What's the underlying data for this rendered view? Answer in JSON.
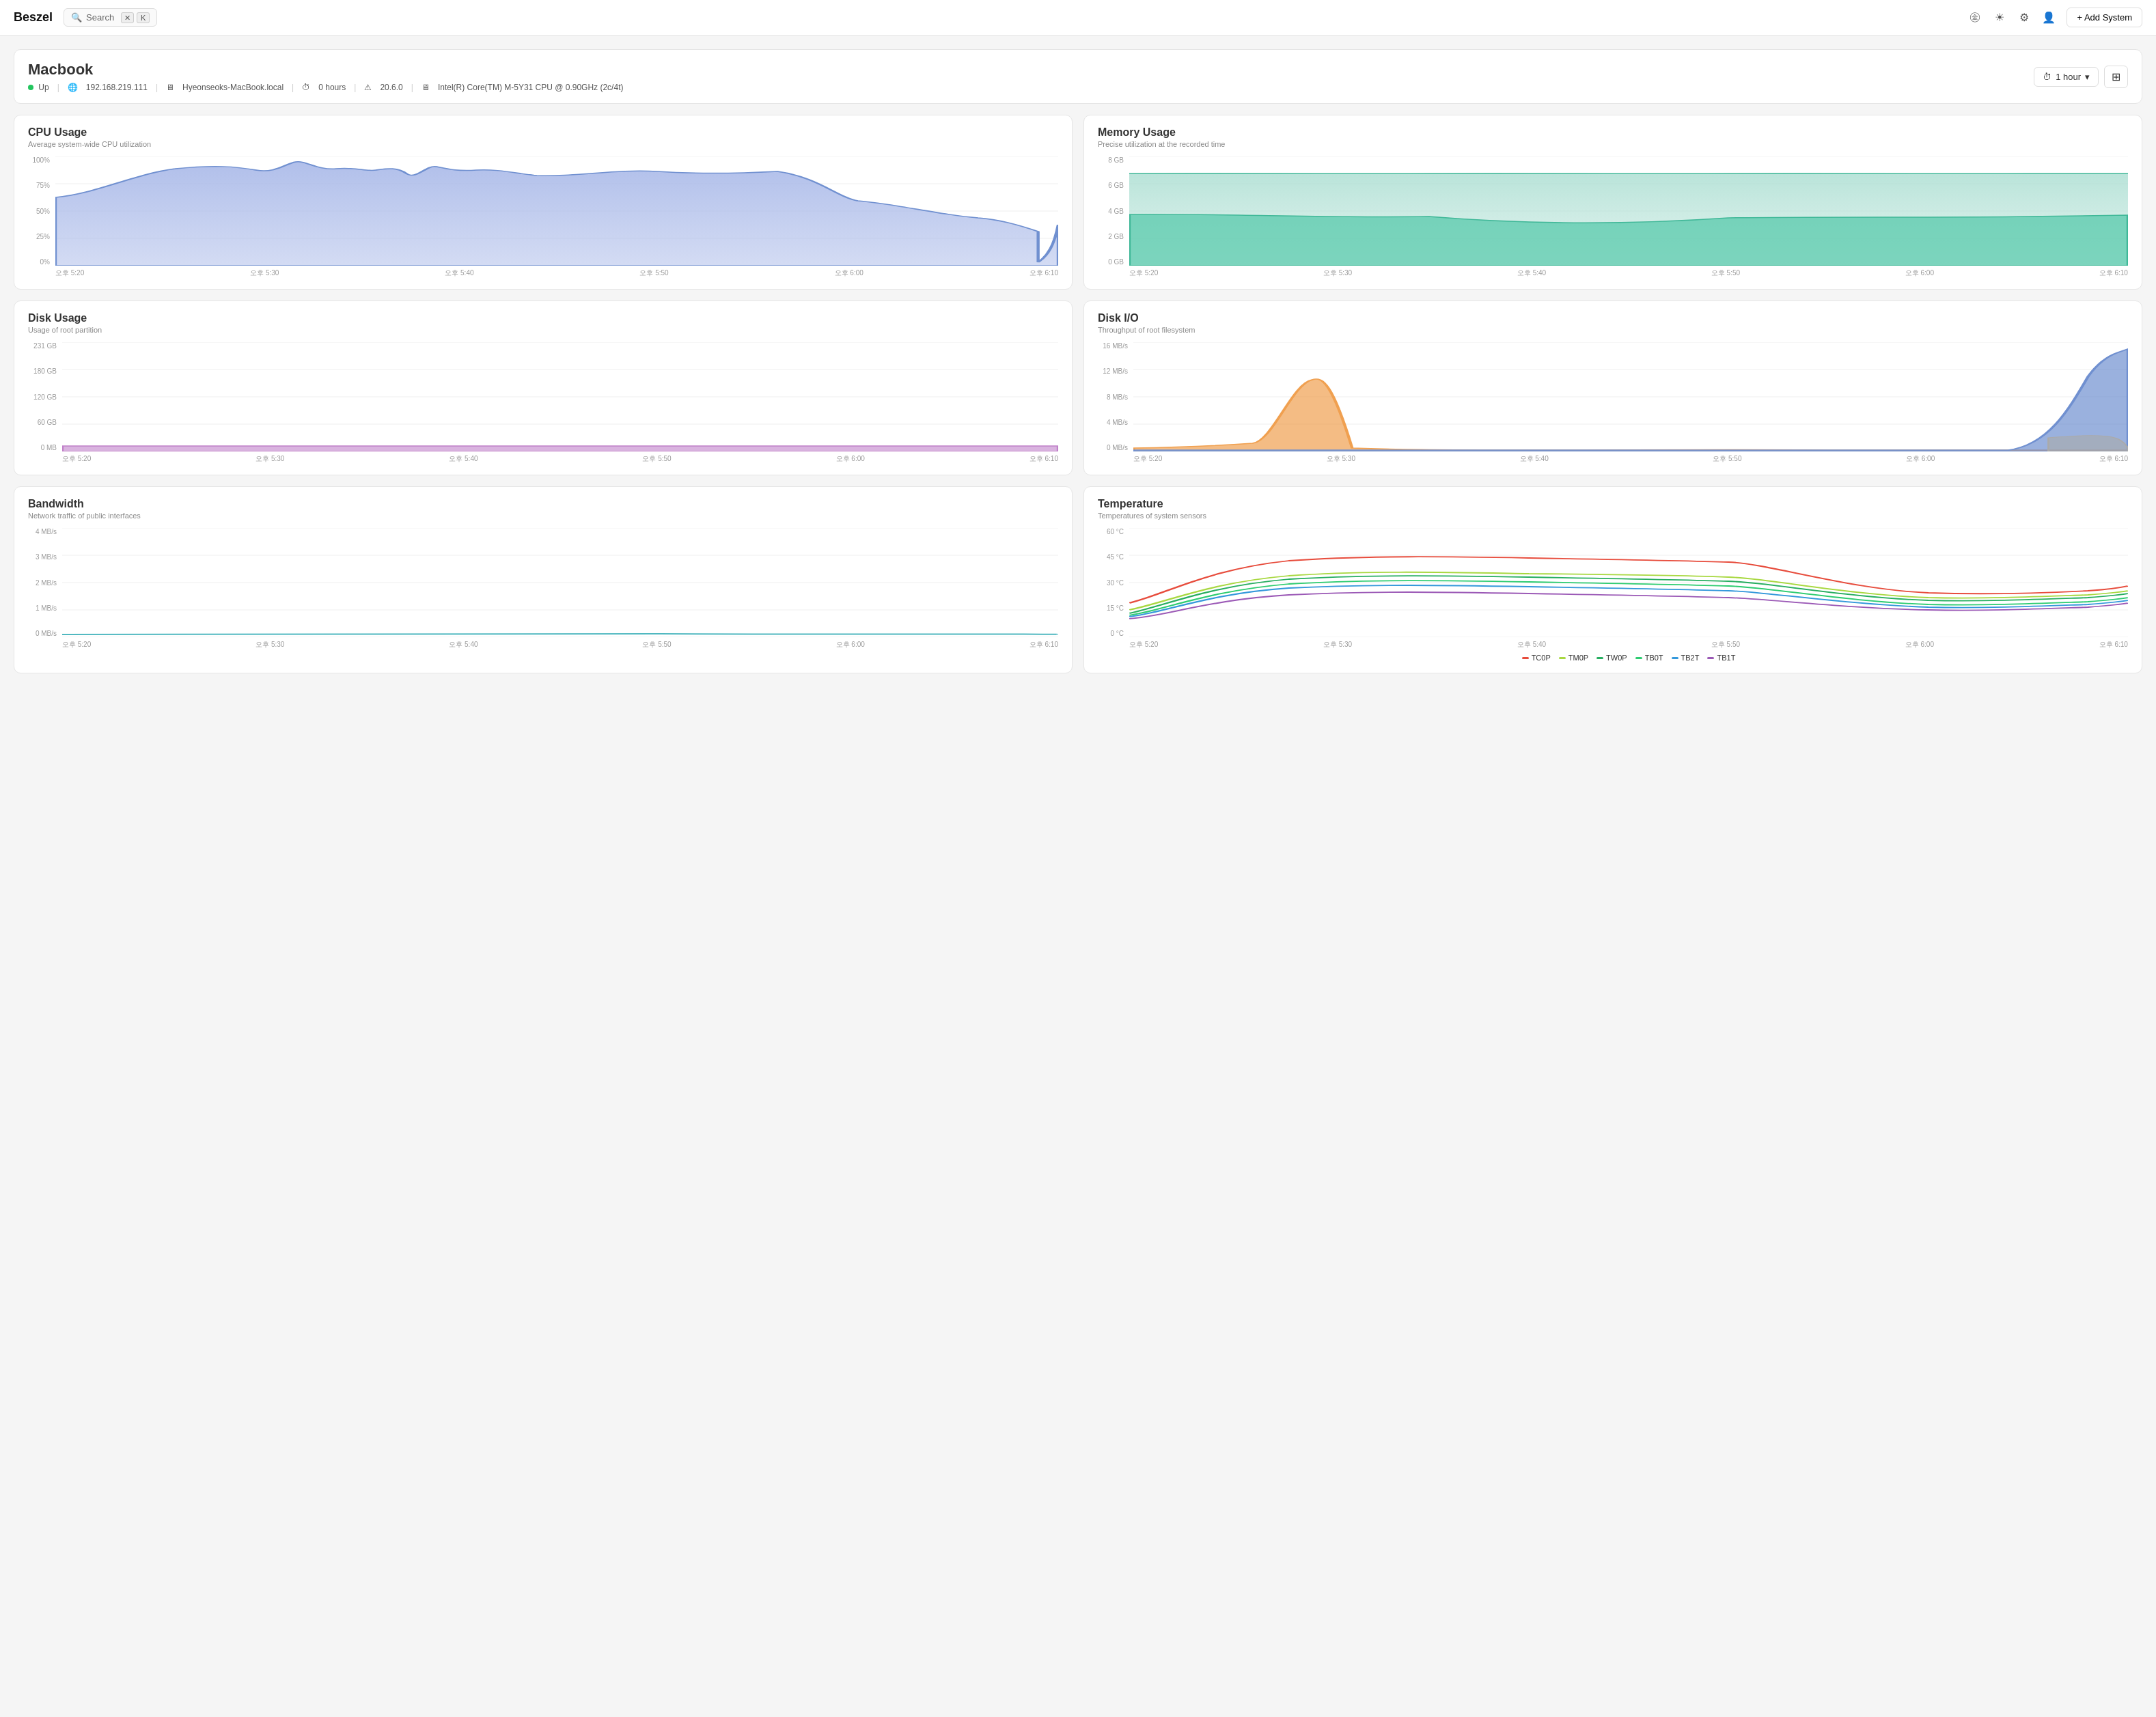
{
  "header": {
    "logo": "Beszel",
    "search": {
      "placeholder": "Search",
      "shortcut": "K"
    },
    "add_system_label": "+ Add System"
  },
  "system": {
    "title": "Macbook",
    "status": "Up",
    "ip": "192.168.219.111",
    "hostname": "Hyeonseoks-MacBook.local",
    "uptime": "0 hours",
    "version": "20.6.0",
    "cpu": "Intel(R) Core(TM) M-5Y31 CPU @ 0.90GHz (2c/4t)",
    "time_range": "1 hour"
  },
  "charts": {
    "cpu": {
      "title": "CPU Usage",
      "subtitle": "Average system-wide CPU utilization",
      "y_labels": [
        "100%",
        "75%",
        "50%",
        "25%",
        "0%"
      ],
      "x_labels": [
        "오후 5:20",
        "오후 5:30",
        "오후 5:40",
        "오후 5:50",
        "오후 6:00",
        "오후 6:10"
      ]
    },
    "memory": {
      "title": "Memory Usage",
      "subtitle": "Precise utilization at the recorded time",
      "y_labels": [
        "8 GB",
        "6 GB",
        "4 GB",
        "2 GB",
        "0 GB"
      ],
      "x_labels": [
        "오후 5:20",
        "오후 5:30",
        "오후 5:40",
        "오후 5:50",
        "오후 6:00",
        "오후 6:10"
      ]
    },
    "disk_usage": {
      "title": "Disk Usage",
      "subtitle": "Usage of root partition",
      "y_labels": [
        "231 GB",
        "180 GB",
        "120 GB",
        "60 GB",
        "0 MB"
      ],
      "x_labels": [
        "오후 5:20",
        "오후 5:30",
        "오후 5:40",
        "오후 5:50",
        "오후 6:00",
        "오후 6:10"
      ]
    },
    "disk_io": {
      "title": "Disk I/O",
      "subtitle": "Throughput of root filesystem",
      "y_labels": [
        "16 MB/s",
        "12 MB/s",
        "8 MB/s",
        "4 MB/s",
        "0 MB/s"
      ],
      "x_labels": [
        "오후 5:20",
        "오후 5:30",
        "오후 5:40",
        "오후 5:50",
        "오후 6:00",
        "오후 6:10"
      ]
    },
    "bandwidth": {
      "title": "Bandwidth",
      "subtitle": "Network traffic of public interfaces",
      "y_labels": [
        "4 MB/s",
        "3 MB/s",
        "2 MB/s",
        "1 MB/s",
        "0 MB/s"
      ],
      "x_labels": [
        "오후 5:20",
        "오후 5:30",
        "오후 5:40",
        "오후 5:50",
        "오후 6:00",
        "오후 6:10"
      ]
    },
    "temperature": {
      "title": "Temperature",
      "subtitle": "Temperatures of system sensors",
      "y_labels": [
        "60 °C",
        "45 °C",
        "30 °C",
        "15 °C",
        "0 °C"
      ],
      "x_labels": [
        "오후 5:20",
        "오후 5:30",
        "오후 5:40",
        "오후 5:50",
        "오후 6:00",
        "오후 6:10"
      ],
      "legend": [
        {
          "name": "TC0P",
          "color": "#e74c3c"
        },
        {
          "name": "TM0P",
          "color": "#a8d840"
        },
        {
          "name": "TW0P",
          "color": "#27ae60"
        },
        {
          "name": "TB0T",
          "color": "#2ecc71"
        },
        {
          "name": "TB2T",
          "color": "#3498db"
        },
        {
          "name": "TB1T",
          "color": "#9b59b6"
        }
      ]
    }
  },
  "colors": {
    "cpu_fill": "#a8b8e8",
    "cpu_stroke": "#7090d0",
    "mem_fill_top": "#a8ddd0",
    "mem_fill_bottom": "#50c8a8",
    "disk_usage_fill": "#d0a0d8",
    "disk_io_blue": "#7090d0",
    "disk_io_orange": "#f0a050",
    "disk_io_gray": "#aaaaaa",
    "bandwidth_teal": "#50b8c0",
    "temp_red": "#e74c3c",
    "temp_yellow": "#a8d840",
    "temp_green": "#27ae60",
    "temp_lightgreen": "#2ecc71",
    "temp_blue": "#3498db",
    "temp_purple": "#9b59b6"
  }
}
